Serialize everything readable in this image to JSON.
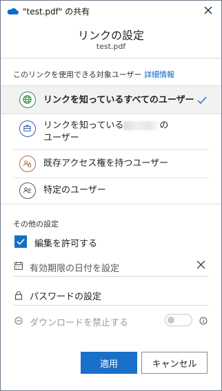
{
  "window": {
    "title": "\"test.pdf\" の共有"
  },
  "header": {
    "title": "リンクの設定",
    "filename": "test.pdf"
  },
  "audience": {
    "label": "このリンクを使用できる対象ユーザー",
    "details_link": "詳細情報",
    "options": [
      {
        "label": "リンクを知っているすべてのユーザー",
        "selected": true,
        "icon": "globe-icon"
      },
      {
        "label_line1": "リンクを知っている",
        "label_line1_suffix": "の",
        "label_line2": "ユーザー",
        "selected": false,
        "icon": "organization-icon"
      },
      {
        "label": "既存アクセス権を持つユーザー",
        "selected": false,
        "icon": "existing-access-icon"
      },
      {
        "label": "特定のユーザー",
        "selected": false,
        "icon": "specific-people-icon"
      }
    ]
  },
  "other_settings": {
    "label": "その他の設定",
    "allow_editing": {
      "label": "編集を許可する",
      "checked": true
    },
    "expiration": {
      "placeholder": "有効期限の日付を設定"
    },
    "password": {
      "label": "パスワードの設定"
    },
    "block_download": {
      "label": "ダウンロードを禁止する",
      "enabled": false
    }
  },
  "buttons": {
    "apply": "適用",
    "cancel": "キャンセル"
  },
  "colors": {
    "accent": "#1a6fc8",
    "globe": "#2e8b3e",
    "org": "#2b5fa8",
    "existing": "#a9704d",
    "specific": "#555555"
  }
}
